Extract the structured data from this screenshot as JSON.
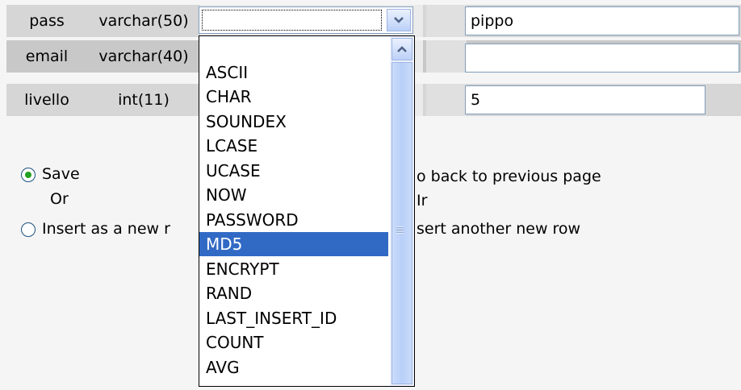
{
  "rows": [
    {
      "field": "pass",
      "type": "varchar(50)",
      "value": "pippo"
    },
    {
      "field": "email",
      "type": "varchar(40)",
      "value": ""
    },
    {
      "field": "livello",
      "type": "int(11)",
      "value": "5"
    }
  ],
  "function_select": {
    "selected": "",
    "options": [
      "ASCII",
      "CHAR",
      "SOUNDEX",
      "LCASE",
      "UCASE",
      "NOW",
      "PASSWORD",
      "MD5",
      "ENCRYPT",
      "RAND",
      "LAST_INSERT_ID",
      "COUNT",
      "AVG"
    ],
    "highlighted": "MD5"
  },
  "actions": {
    "save_label": "Save",
    "or_left": "Or",
    "insert_label": "Insert as a new r",
    "go_back_label": "o back to previous page",
    "or_right": "Ir",
    "insert_another_label": "sert another new row"
  },
  "icons": {
    "dropdown_arrow": "chevron-down-icon",
    "scroll_up": "chevron-up-icon"
  },
  "colors": {
    "selection": "#316ac5",
    "radio_checked": "#21a121"
  }
}
